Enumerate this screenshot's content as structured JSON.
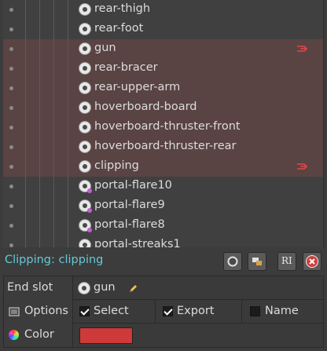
{
  "tree": {
    "items": [
      {
        "label": "rear-thigh",
        "portal": false,
        "clipped": false,
        "marker": false
      },
      {
        "label": "rear-foot",
        "portal": false,
        "clipped": false,
        "marker": false
      },
      {
        "label": "gun",
        "portal": false,
        "clipped": true,
        "marker": true
      },
      {
        "label": "rear-bracer",
        "portal": false,
        "clipped": true,
        "marker": false
      },
      {
        "label": "rear-upper-arm",
        "portal": false,
        "clipped": true,
        "marker": false
      },
      {
        "label": "hoverboard-board",
        "portal": false,
        "clipped": true,
        "marker": false
      },
      {
        "label": "hoverboard-thruster-front",
        "portal": false,
        "clipped": true,
        "marker": false
      },
      {
        "label": "hoverboard-thruster-rear",
        "portal": false,
        "clipped": true,
        "marker": false
      },
      {
        "label": "clipping",
        "portal": false,
        "clipped": true,
        "marker": true
      },
      {
        "label": "portal-flare10",
        "portal": true,
        "clipped": false,
        "marker": false
      },
      {
        "label": "portal-flare9",
        "portal": true,
        "clipped": false,
        "marker": false
      },
      {
        "label": "portal-flare8",
        "portal": true,
        "clipped": false,
        "marker": false
      },
      {
        "label": "portal-streaks1",
        "portal": true,
        "clipped": false,
        "marker": false
      }
    ]
  },
  "panel": {
    "title": "Clipping: clipping",
    "toolbar": {
      "btn1_icon": "circle-icon",
      "btn2_icon": "key-icon",
      "btn3_label": "RI",
      "btn4_icon": "delete-icon"
    },
    "end_slot": {
      "label": "End slot",
      "value": "gun"
    },
    "options": {
      "label": "Options",
      "select": {
        "label": "Select",
        "checked": true
      },
      "export": {
        "label": "Export",
        "checked": true
      },
      "name": {
        "label": "Name",
        "checked": false
      }
    },
    "color": {
      "label": "Color",
      "value": "#ce3a3a"
    }
  },
  "colors": {
    "accent_cyan": "#64c8d8",
    "clip_range_bg": "#5a4343",
    "delete_red": "#d23c3c"
  }
}
